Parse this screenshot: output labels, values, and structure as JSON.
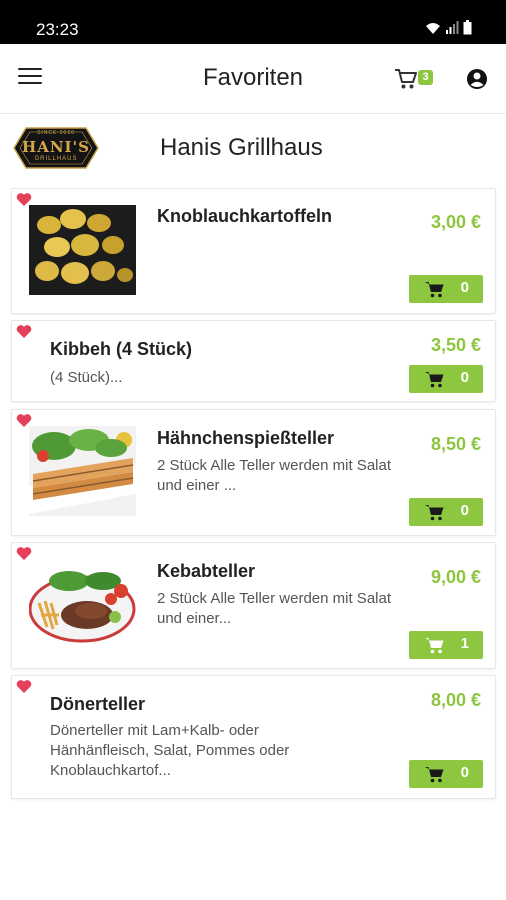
{
  "status_bar": {
    "time": "23:23"
  },
  "app_bar": {
    "title": "Favoriten",
    "cart_count": "3"
  },
  "restaurant": {
    "name": "Hanis Grillhaus",
    "logo_text": "HANI'S",
    "logo_sub": "GRILLHAUS",
    "logo_top": "SINCE 2020"
  },
  "colors": {
    "accent": "#8dc63f",
    "heart": "#e5405a"
  },
  "items": [
    {
      "name": "Knoblauchkartoffeln",
      "description": "",
      "price": "3,00 €",
      "qty": "0",
      "image": "potatoes"
    },
    {
      "name": "Kibbeh (4 Stück)",
      "description": "(4 Stück)...",
      "price": "3,50 €",
      "qty": "0",
      "image": ""
    },
    {
      "name": "Hähnchenspießteller",
      "description": "2 Stück Alle Teller werden mit Salat und einer ...",
      "price": "8,50 €",
      "qty": "0",
      "image": "skewers"
    },
    {
      "name": "Kebabteller",
      "description": "2 Stück Alle Teller werden mit Salat und einer...",
      "price": "9,00 €",
      "qty": "1",
      "image": "kebab-plate"
    },
    {
      "name": "Dönerteller",
      "description": "Dönerteller mit Lam+Kalb- oder Hänhänfleisch, Salat, Pommes oder Knoblauchkartof...",
      "price": "8,00 €",
      "qty": "0",
      "image": ""
    }
  ]
}
